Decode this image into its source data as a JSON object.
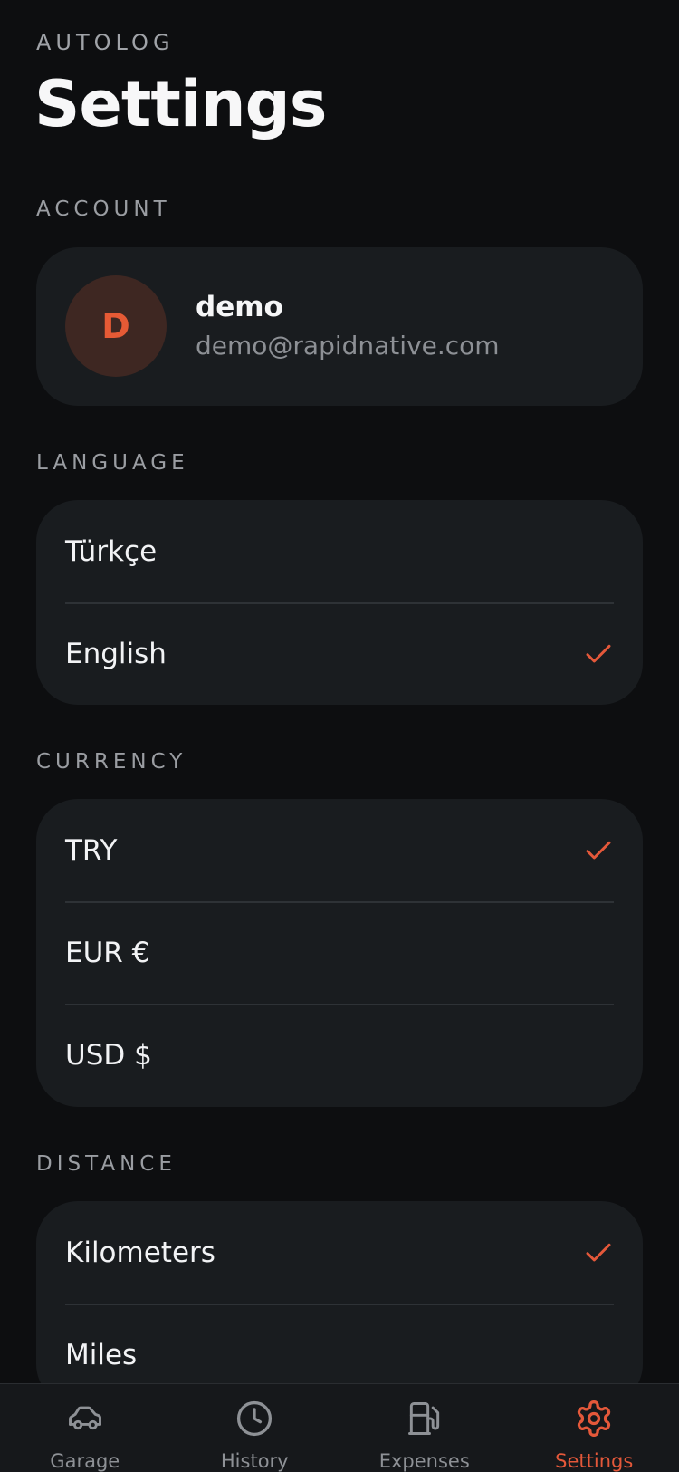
{
  "header": {
    "brand": "AUTOLOG",
    "title": "Settings"
  },
  "account": {
    "section_label": "ACCOUNT",
    "avatar_initial": "D",
    "name": "demo",
    "email": "demo@rapidnative.com"
  },
  "language": {
    "section_label": "LANGUAGE",
    "options": [
      {
        "label": "Türkçe",
        "selected": false
      },
      {
        "label": "English",
        "selected": true
      }
    ]
  },
  "currency": {
    "section_label": "CURRENCY",
    "options": [
      {
        "label": "TRY",
        "selected": true
      },
      {
        "label": "EUR €",
        "selected": false
      },
      {
        "label": "USD $",
        "selected": false
      }
    ]
  },
  "distance": {
    "section_label": "DISTANCE",
    "options": [
      {
        "label": "Kilometers",
        "selected": true
      },
      {
        "label": "Miles",
        "selected": false
      }
    ]
  },
  "tabs": [
    {
      "label": "Garage",
      "icon": "car-icon",
      "active": false
    },
    {
      "label": "History",
      "icon": "clock-icon",
      "active": false
    },
    {
      "label": "Expenses",
      "icon": "fuel-pump-icon",
      "active": false
    },
    {
      "label": "Settings",
      "icon": "gear-icon",
      "active": true
    }
  ],
  "colors": {
    "accent": "#e4583a",
    "background": "#0d0e10",
    "card": "#191c1f",
    "muted": "#9a9da2"
  }
}
